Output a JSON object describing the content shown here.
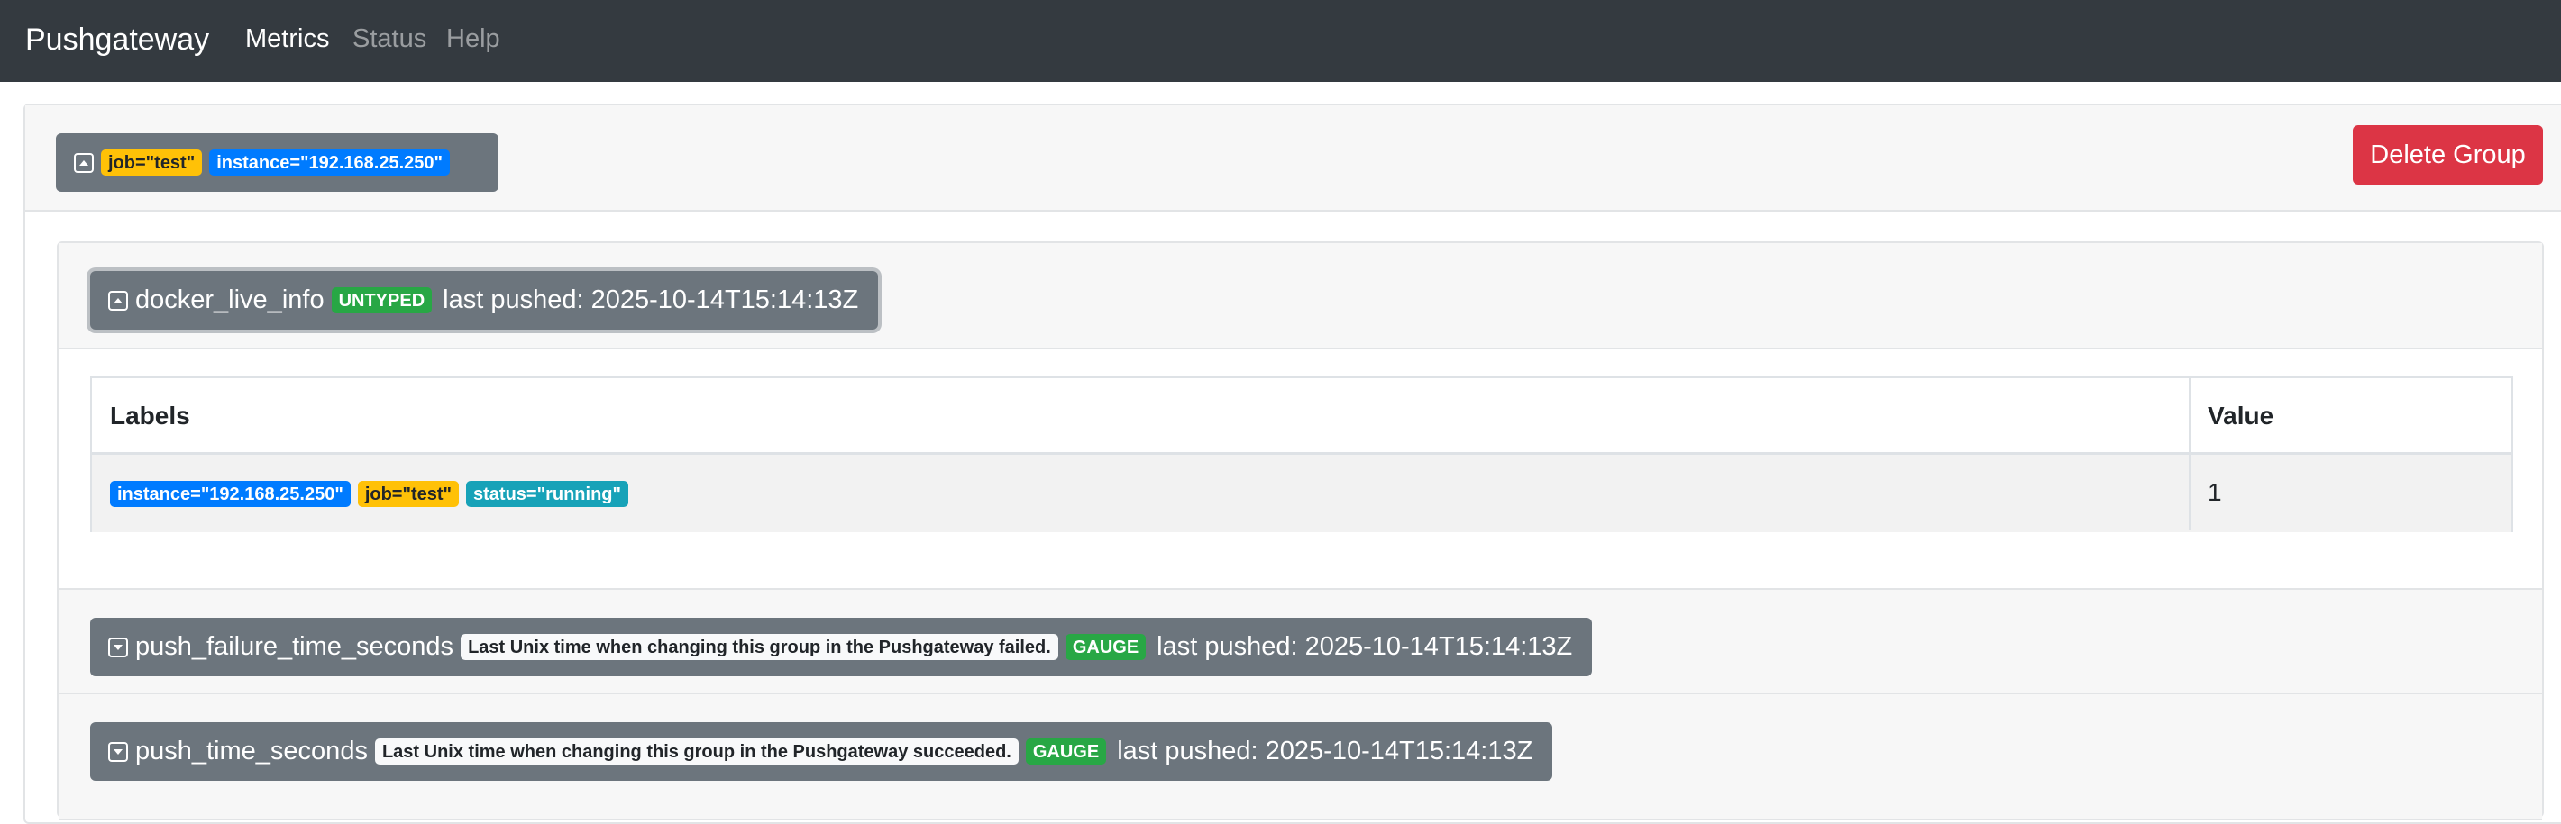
{
  "navbar": {
    "brand": "Pushgateway",
    "links": [
      {
        "label": "Metrics",
        "active": true
      },
      {
        "label": "Status",
        "active": false
      },
      {
        "label": "Help",
        "active": false
      }
    ]
  },
  "group": {
    "labels": [
      {
        "text": "job=\"test\"",
        "style": "warning"
      },
      {
        "text": "instance=\"192.168.25.250\"",
        "style": "primary"
      }
    ],
    "delete_label": "Delete Group"
  },
  "metrics": [
    {
      "name": "docker_live_info",
      "type_badge": "UNTYPED",
      "help": "",
      "last_pushed": "last pushed: 2025-10-14T15:14:13Z",
      "expanded": true,
      "table": {
        "headers": [
          "Labels",
          "Value"
        ],
        "rows": [
          {
            "labels": [
              "instance=\"192.168.25.250\"",
              "job=\"test\"",
              "status=\"running\""
            ],
            "value": "1"
          }
        ]
      }
    },
    {
      "name": "push_failure_time_seconds",
      "type_badge": "GAUGE",
      "help": "Last Unix time when changing this group in the Pushgateway failed.",
      "last_pushed": "last pushed: 2025-10-14T15:14:13Z",
      "expanded": false
    },
    {
      "name": "push_time_seconds",
      "type_badge": "GAUGE",
      "help": "Last Unix time when changing this group in the Pushgateway succeeded.",
      "last_pushed": "last pushed: 2025-10-14T15:14:13Z",
      "expanded": false
    }
  ],
  "colors": {
    "navbar": "#343a40",
    "secondary": "#6c757d",
    "danger": "#dc3545",
    "warning": "#ffc107",
    "primary": "#007bff",
    "info": "#17a2b8",
    "success": "#28a745"
  },
  "icons": {
    "collapse": "caret-up-square-icon",
    "expand": "caret-down-square-icon"
  }
}
